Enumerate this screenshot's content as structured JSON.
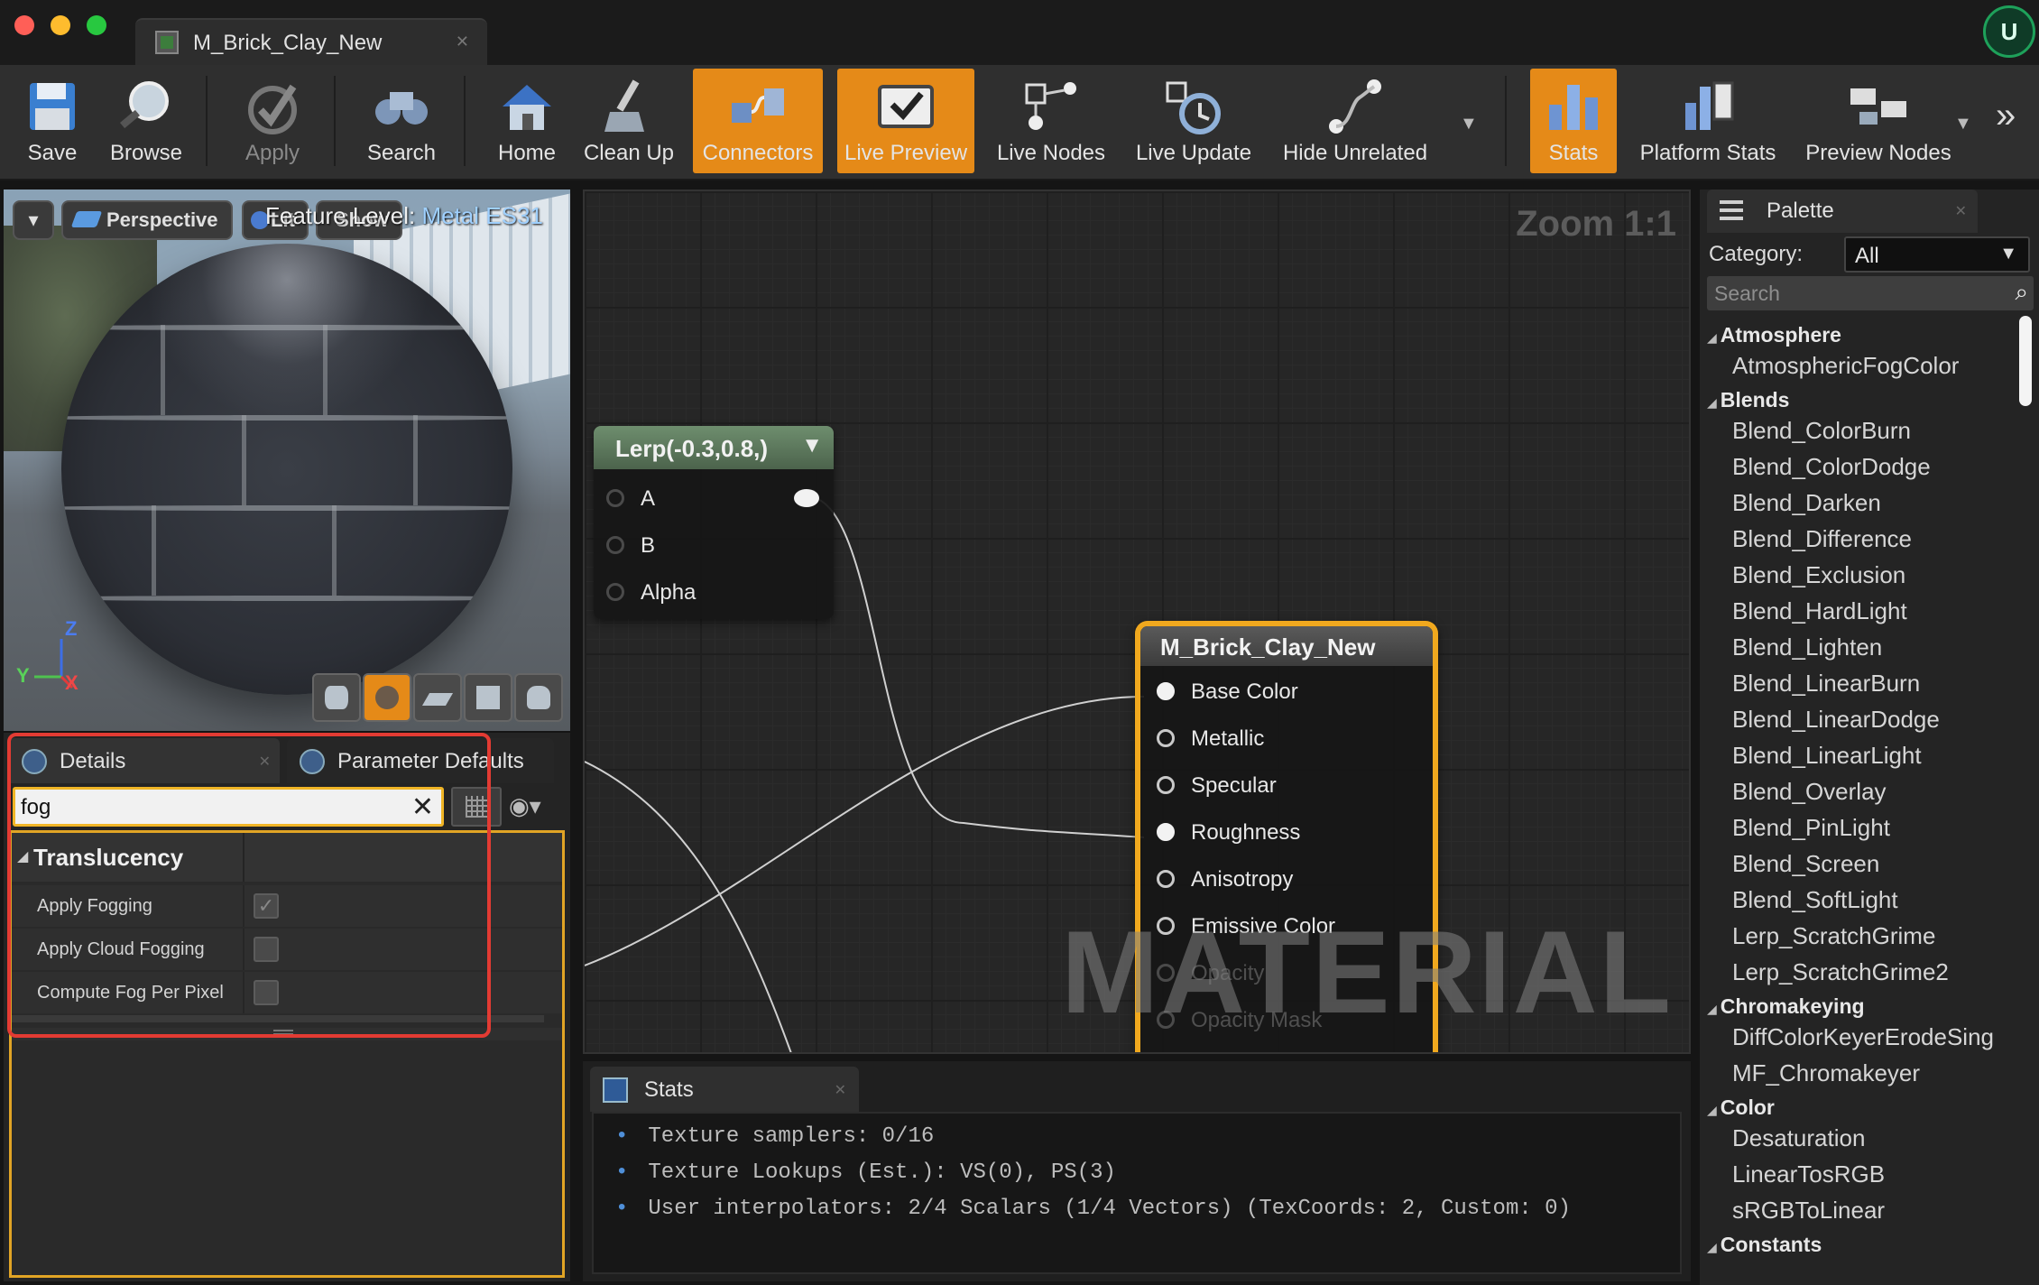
{
  "window": {
    "tab_title": "M_Brick_Clay_New",
    "traffic_colors": [
      "#ff5f57",
      "#febc2e",
      "#28c840"
    ]
  },
  "toolbar": {
    "items": [
      {
        "label": "Save",
        "icon": "save-icon",
        "state": "normal"
      },
      {
        "label": "Browse",
        "icon": "browse-icon",
        "state": "normal"
      },
      {
        "label": "Apply",
        "icon": "apply-icon",
        "state": "disabled"
      },
      {
        "label": "Search",
        "icon": "search-icon",
        "state": "normal"
      },
      {
        "label": "Home",
        "icon": "home-icon",
        "state": "normal"
      },
      {
        "label": "Clean Up",
        "icon": "clean-up-icon",
        "state": "normal"
      },
      {
        "label": "Connectors",
        "icon": "connectors-icon",
        "state": "active"
      },
      {
        "label": "Live Preview",
        "icon": "live-preview-icon",
        "state": "active"
      },
      {
        "label": "Live Nodes",
        "icon": "live-nodes-icon",
        "state": "normal"
      },
      {
        "label": "Live Update",
        "icon": "live-update-icon",
        "state": "normal"
      },
      {
        "label": "Hide Unrelated",
        "icon": "hide-unrelated-icon",
        "state": "normal"
      },
      {
        "label": "Stats",
        "icon": "stats-icon",
        "state": "active"
      },
      {
        "label": "Platform Stats",
        "icon": "platform-stats-icon",
        "state": "normal"
      },
      {
        "label": "Preview Nodes",
        "icon": "preview-nodes-icon",
        "state": "normal"
      }
    ],
    "active_color": "#e58a18"
  },
  "viewport": {
    "view_mode": "Perspective",
    "lit_label": "Lit",
    "show_label": "Show",
    "feature_level_label": "Feature Level:",
    "feature_level_value": "Metal ES31",
    "axis_x": "X",
    "axis_y": "Y",
    "axis_z": "Z",
    "preview_shapes": [
      "cylinder-icon",
      "sphere-icon",
      "plane-icon",
      "cube-icon",
      "teapot-icon"
    ]
  },
  "details": {
    "tabs": [
      {
        "label": "Details"
      },
      {
        "label": "Parameter Defaults"
      }
    ],
    "search_value": "fog",
    "category": "Translucency",
    "properties": [
      {
        "label": "Apply Fogging",
        "checked": true
      },
      {
        "label": "Apply Cloud Fogging",
        "checked": false
      },
      {
        "label": "Compute Fog Per Pixel",
        "checked": false
      }
    ],
    "highlight_color": "#e33b33"
  },
  "graph": {
    "zoom_label": "Zoom 1:1",
    "watermark": "MATERIAL",
    "lerp_node": {
      "title": "Lerp(-0.3,0.8,)",
      "pins": [
        "A",
        "B",
        "Alpha"
      ],
      "header_color": "#5d7a5d"
    },
    "result_node": {
      "title": "M_Brick_Clay_New",
      "pins": [
        {
          "label": "Base Color",
          "connected": true,
          "enabled": true
        },
        {
          "label": "Metallic",
          "connected": false,
          "enabled": true
        },
        {
          "label": "Specular",
          "connected": false,
          "enabled": true
        },
        {
          "label": "Roughness",
          "connected": true,
          "enabled": true
        },
        {
          "label": "Anisotropy",
          "connected": false,
          "enabled": true
        },
        {
          "label": "Emissive Color",
          "connected": false,
          "enabled": true
        },
        {
          "label": "Opacity",
          "connected": false,
          "enabled": false
        },
        {
          "label": "Opacity Mask",
          "connected": false,
          "enabled": false
        }
      ],
      "border_color": "#f0a81e"
    }
  },
  "stats": {
    "tab_label": "Stats",
    "lines": [
      "Texture samplers: 0/16",
      "Texture Lookups (Est.): VS(0), PS(3)",
      "User interpolators: 2/4 Scalars (1/4 Vectors) (TexCoords: 2, Custom: 0)"
    ]
  },
  "palette": {
    "tab_label": "Palette",
    "category_label": "Category:",
    "category_value": "All",
    "search_placeholder": "Search",
    "groups": [
      {
        "name": "Atmosphere",
        "items": [
          "AtmosphericFogColor"
        ]
      },
      {
        "name": "Blends",
        "items": [
          "Blend_ColorBurn",
          "Blend_ColorDodge",
          "Blend_Darken",
          "Blend_Difference",
          "Blend_Exclusion",
          "Blend_HardLight",
          "Blend_Lighten",
          "Blend_LinearBurn",
          "Blend_LinearDodge",
          "Blend_LinearLight",
          "Blend_Overlay",
          "Blend_PinLight",
          "Blend_Screen",
          "Blend_SoftLight",
          "Lerp_ScratchGrime",
          "Lerp_ScratchGrime2"
        ]
      },
      {
        "name": "Chromakeying",
        "items": [
          "DiffColorKeyerErodeSing",
          "MF_Chromakeyer"
        ]
      },
      {
        "name": "Color",
        "items": [
          "Desaturation",
          "LinearTosRGB",
          "sRGBToLinear"
        ]
      },
      {
        "name": "Constants",
        "items": []
      }
    ]
  }
}
